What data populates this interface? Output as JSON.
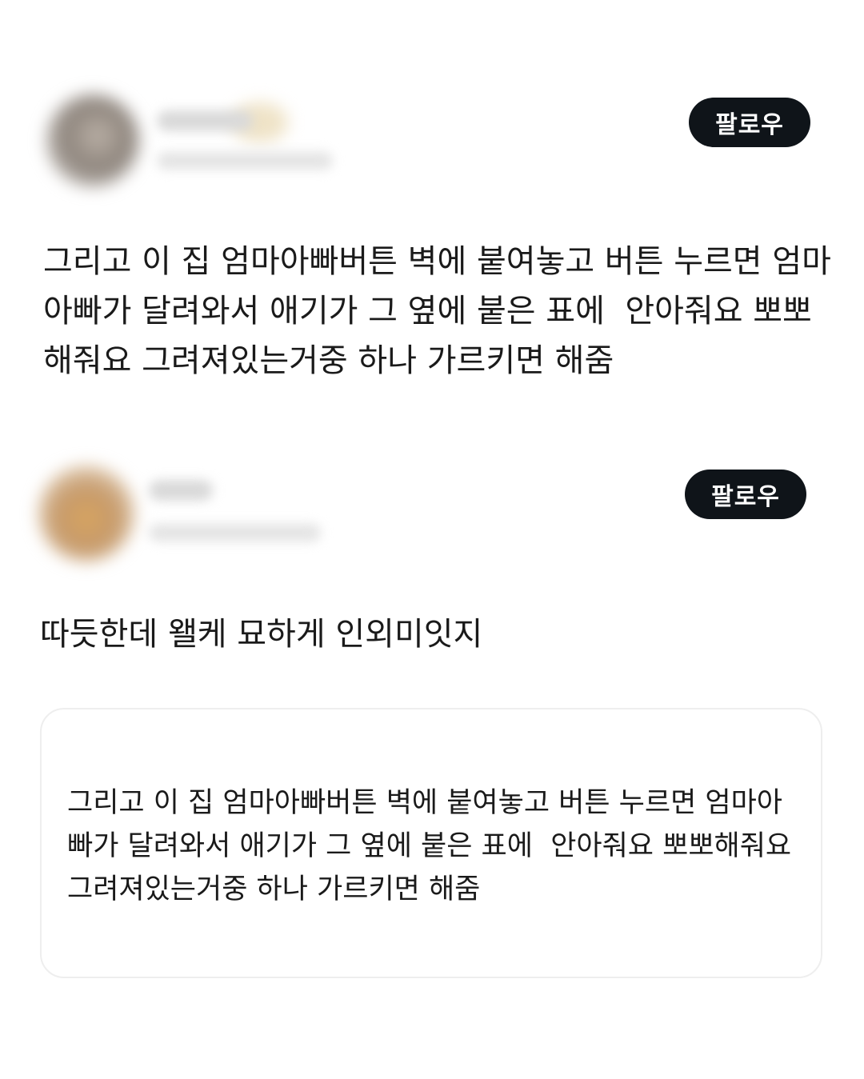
{
  "posts": [
    {
      "follow_label": "팔로우",
      "text": "그리고 이 집 엄마아빠버튼 벽에 붙여놓고 버튼 누르면 엄마아빠가 달려와서 애기가 그 옆에 붙은 표에  안아줘요 뽀뽀해줘요 그려져있는거중 하나 가르키면 해줌"
    },
    {
      "follow_label": "팔로우",
      "text": "따듯한데 왤케 묘하게 인외미잇지",
      "quote": {
        "text": "그리고 이 집 엄마아빠버튼 벽에 붙여놓고 버튼 누르면 엄마아빠가 달려와서 애기가 그 옆에 붙은 표에  안아줘요 뽀뽀해줘요 그려져있는거중 하나 가르키면 해줌"
      }
    }
  ]
}
